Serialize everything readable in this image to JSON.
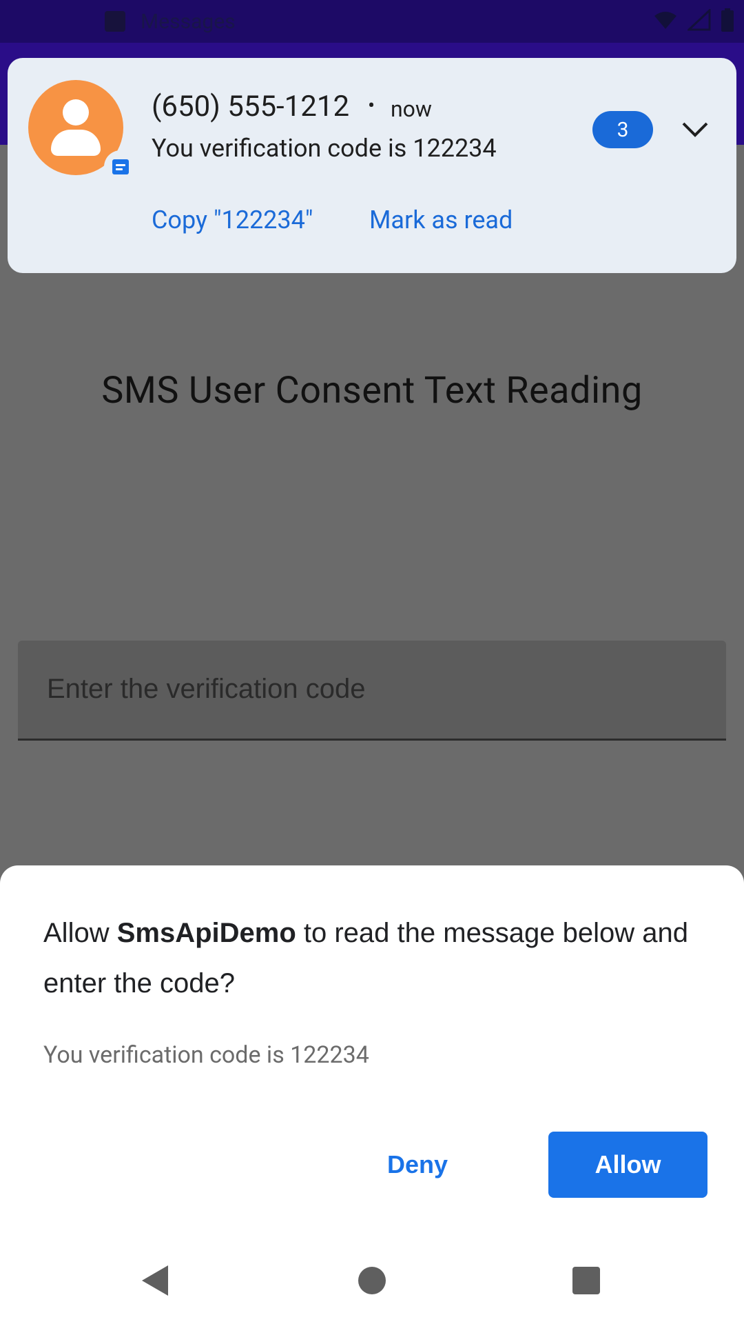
{
  "status_bar": {
    "app_label": "Messages",
    "icons": [
      "message-icon",
      "wifi-icon",
      "signal-icon",
      "battery-icon"
    ]
  },
  "app": {
    "title": "SMS User Consent Text Reading",
    "code_field_placeholder": "Enter the verification code"
  },
  "notification": {
    "sender": "(650) 555-1212",
    "separator": "•",
    "time": "now",
    "text": "You verification code is 122234",
    "unread_count": "3",
    "actions": {
      "copy": "Copy \"122234\"",
      "mark_read": "Mark as read"
    }
  },
  "dialog": {
    "title_prefix": "Allow ",
    "app_name": "SmsApiDemo",
    "title_suffix": " to read the message below and enter the code?",
    "message": "You verification code is 122234",
    "deny_label": "Deny",
    "allow_label": "Allow"
  },
  "colors": {
    "accent": "#1a73e8",
    "avatar": "#f79344",
    "scrim_background": "#6b6b6b",
    "status_bar": "#1d0a66"
  }
}
